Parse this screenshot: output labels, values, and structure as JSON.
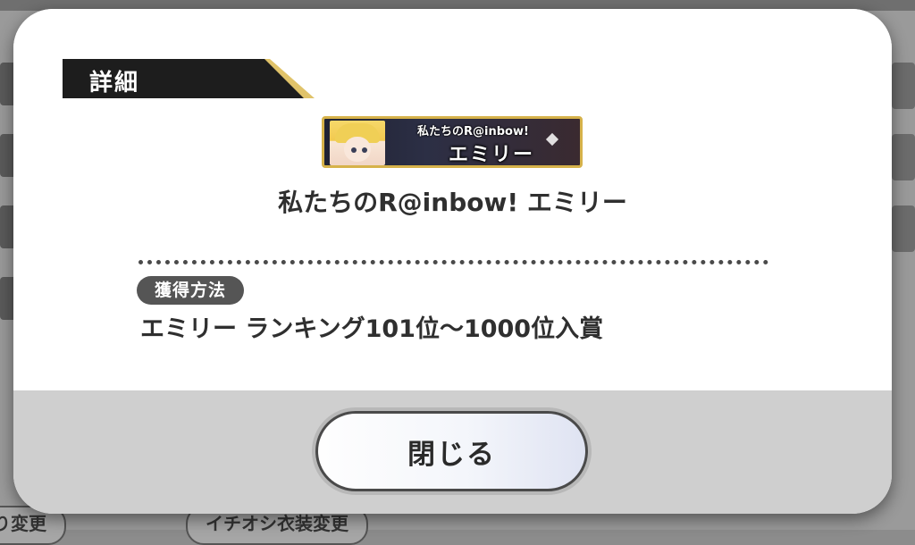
{
  "background": {
    "bottom_left_button": "り変更",
    "bottom_right_button": "イチオシ衣装変更"
  },
  "dialog": {
    "header_title": "詳細",
    "badge": {
      "top_text": "私たちのR@inbow!",
      "name_text": "エミリー"
    },
    "item_title": "私たちのR@inbow! エミリー",
    "acquisition_label": "獲得方法",
    "acquisition_method": "エミリー ランキング101位～1000位入賞",
    "close_button": "閉じる"
  },
  "colors": {
    "header_bg": "#1d1d1d",
    "header_accent": "#e0c36a",
    "badge_border": "#d6b24a",
    "footer_bg": "#cfcfcf",
    "label_pill": "#555555"
  }
}
